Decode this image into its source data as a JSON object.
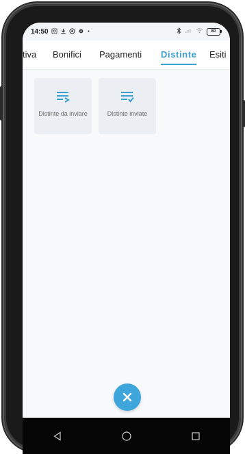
{
  "status_bar": {
    "time": "14:50",
    "left_icons": [
      "photo-icon",
      "download-icon",
      "whatsapp-icon",
      "settings-icon",
      "dot-icon"
    ],
    "right_icons": [
      "bluetooth-icon",
      "signal-icon",
      "wifi-icon"
    ],
    "battery": "80"
  },
  "tabs": [
    {
      "label": "tiva",
      "active": false
    },
    {
      "label": "Bonifici",
      "active": false
    },
    {
      "label": "Pagamenti",
      "active": false
    },
    {
      "label": "Distinte",
      "active": true
    },
    {
      "label": "Esiti",
      "active": false
    }
  ],
  "tiles": [
    {
      "label": "Distinte da inviare",
      "icon": "list-send-icon"
    },
    {
      "label": "Distinte inviate",
      "icon": "list-check-icon"
    }
  ],
  "fab": {
    "icon": "close-icon"
  },
  "nav": {
    "icons": [
      "back-icon",
      "home-icon",
      "recents-icon"
    ]
  },
  "colors": {
    "accent": "#3b9fd0",
    "fab": "#3fa6db",
    "tile_bg": "#ebeef2"
  }
}
